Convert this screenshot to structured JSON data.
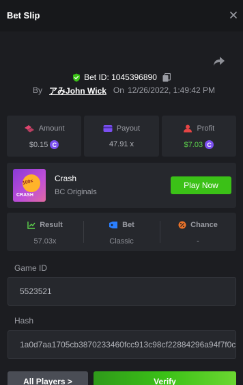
{
  "header": {
    "title": "Bet Slip",
    "close_icon": "close-icon"
  },
  "share_icon": "share-icon",
  "bet": {
    "id_label": "Bet ID: 1045396890",
    "shield_icon": "shield-check-icon",
    "copy_icon": "copy-icon",
    "by_label": "By",
    "username": "アみJohn Wick",
    "on_label": "On",
    "date": "12/26/2022, 1:49:42 PM"
  },
  "stats": [
    {
      "icon": "amount-icon",
      "label": "Amount",
      "value": "$0.15",
      "coin": "C",
      "color": "#b3b5bb"
    },
    {
      "icon": "payout-icon",
      "label": "Payout",
      "value": "47.91 x",
      "coin": "",
      "color": "#b3b5bb"
    },
    {
      "icon": "profit-icon",
      "label": "Profit",
      "value": "$7.03",
      "coin": "C",
      "color": "#5ed74d"
    }
  ],
  "game": {
    "thumb_multiplier": "100x",
    "thumb_name": "CRASH",
    "name": "Crash",
    "provider": "BC Originals",
    "play_label": "Play Now"
  },
  "info": [
    {
      "icon": "result-icon",
      "label": "Result",
      "value": "57.03x"
    },
    {
      "icon": "bet-tag-icon",
      "label": "Bet",
      "value": "Classic"
    },
    {
      "icon": "percent-icon",
      "label": "Chance",
      "value": "-"
    }
  ],
  "fields": {
    "game_id_label": "Game ID",
    "game_id_value": "5523521",
    "hash_label": "Hash",
    "hash_value": "1a0d7aa1705cb3870233460fcc913c98cf22884296a94f7f0c"
  },
  "buttons": {
    "players_label": "All Players >",
    "verify_label": "Verify"
  },
  "colors": {
    "accent_green": "#3bc117",
    "coin_purple": "#7b4ff0",
    "background": "#1c1d21"
  }
}
